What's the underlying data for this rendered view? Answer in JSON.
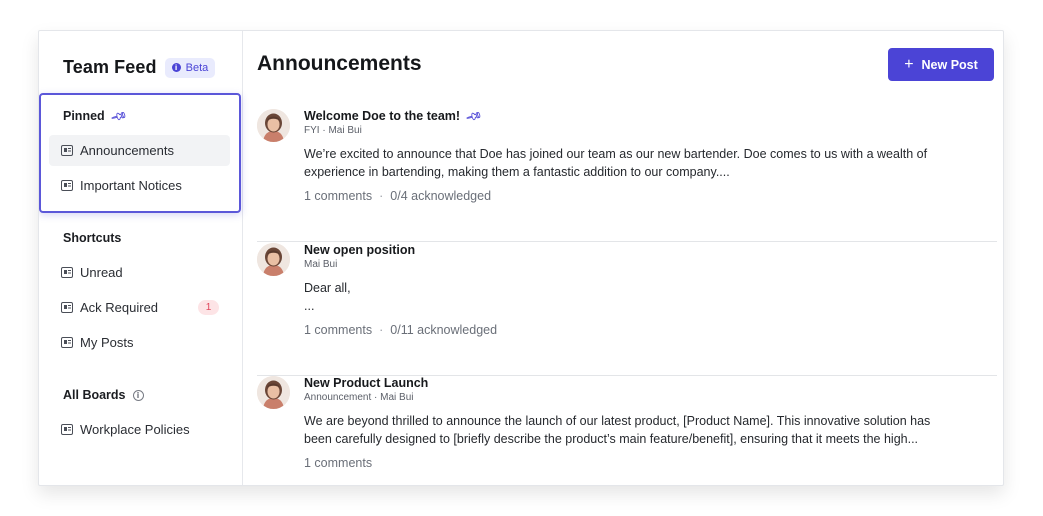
{
  "brand": {
    "title": "Team Feed",
    "badge": "Beta"
  },
  "sidebar": {
    "pinned_title": "Pinned",
    "pinned_items": [
      {
        "label": "Announcements",
        "active": true
      },
      {
        "label": "Important Notices"
      }
    ],
    "shortcuts_title": "Shortcuts",
    "shortcuts": [
      {
        "label": "Unread"
      },
      {
        "label": "Ack Required",
        "count": "1"
      },
      {
        "label": "My Posts"
      }
    ],
    "boards_title": "All Boards",
    "boards": [
      {
        "label": "Workplace Policies"
      }
    ]
  },
  "main": {
    "title": "Announcements",
    "new_post_label": "New Post",
    "posts": [
      {
        "title": "Welcome Doe to the team!",
        "pinned": true,
        "meta": "FYI · Mai Bui",
        "body_line1": "We’re excited to announce that Doe has joined our team as our new bartender. Doe comes to us with a wealth of",
        "body_line2": "experience in bartending, making them a fantastic addition to our company....",
        "comments": "1 comments",
        "acknowledged": "0/4 acknowledged"
      },
      {
        "title": "New open position",
        "meta": "Mai Bui",
        "body_line1": "Dear all,",
        "body_line2": "...",
        "comments": "1 comments",
        "acknowledged": "0/11 acknowledged"
      },
      {
        "title": "New Product Launch",
        "meta": "Announcement · Mai Bui",
        "body_line1": "We are beyond thrilled to announce the launch of our latest product, [Product Name]. This innovative solution has",
        "body_line2": "been carefully designed to [briefly describe the product’s main feature/benefit], ensuring that it meets the high...",
        "comments": "1 comments"
      }
    ]
  },
  "colors": {
    "accent": "#4b44d6",
    "highlight_border": "#5b57d9",
    "badge_bg": "#fde4e6",
    "badge_text": "#e0455b"
  }
}
